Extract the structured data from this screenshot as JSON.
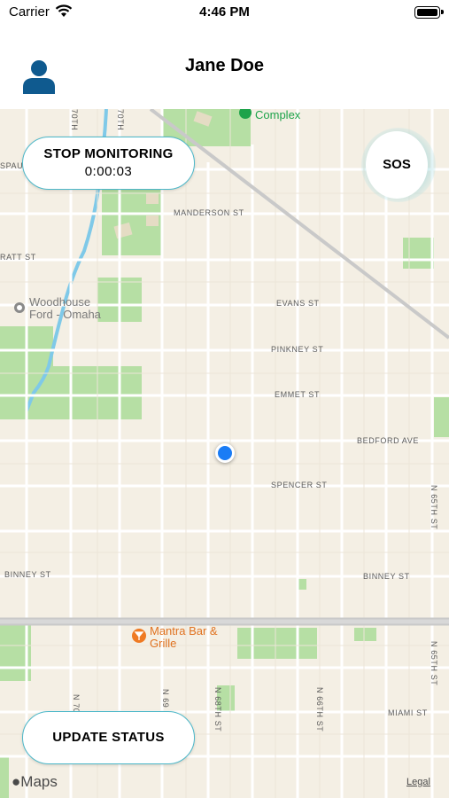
{
  "status_bar": {
    "carrier": "Carrier",
    "time": "4:46 PM"
  },
  "header": {
    "title": "Jane Doe"
  },
  "monitoring": {
    "label": "STOP MONITORING",
    "timer": "0:00:03"
  },
  "sos": {
    "label": "SOS"
  },
  "update": {
    "label": "UPDATE STATUS"
  },
  "map": {
    "streets": {
      "manderson": "MANDERSON ST",
      "ratt": "RATT ST",
      "evans": "EVANS ST",
      "pinkney": "PINKNEY ST",
      "emmet": "EMMET ST",
      "bedford": "BEDFORD AVE",
      "spencer": "SPENCER ST",
      "binney_left": "BINNEY ST",
      "binney_right": "BINNEY ST",
      "miami": "MIAMI ST",
      "n65th": "N 65TH ST",
      "n65th_lower": "N 65TH ST",
      "n66th": "N 66TH ST",
      "n68th": "N 68TH ST",
      "n69": "N 69",
      "n70": "N 70T",
      "n70_top": "70TH",
      "spau": "SPAU"
    },
    "pois": {
      "complex": "Complex",
      "woodhouse_line1": "Woodhouse",
      "woodhouse_line2": "Ford - Omaha",
      "mantra_line1": "Mantra Bar &",
      "mantra_line2": "Grille"
    },
    "attribution": {
      "maps": "Maps",
      "legal": "Legal"
    },
    "colors": {
      "land": "#f4efe4",
      "park": "#b6dfa4",
      "road": "#ffffff",
      "highway": "#c9c9c9",
      "water": "#7fc9e8",
      "accent": "#4db8c9",
      "location": "#1a7cf5",
      "poi_green": "#1ea34a",
      "poi_orange": "#ef7a23"
    }
  }
}
